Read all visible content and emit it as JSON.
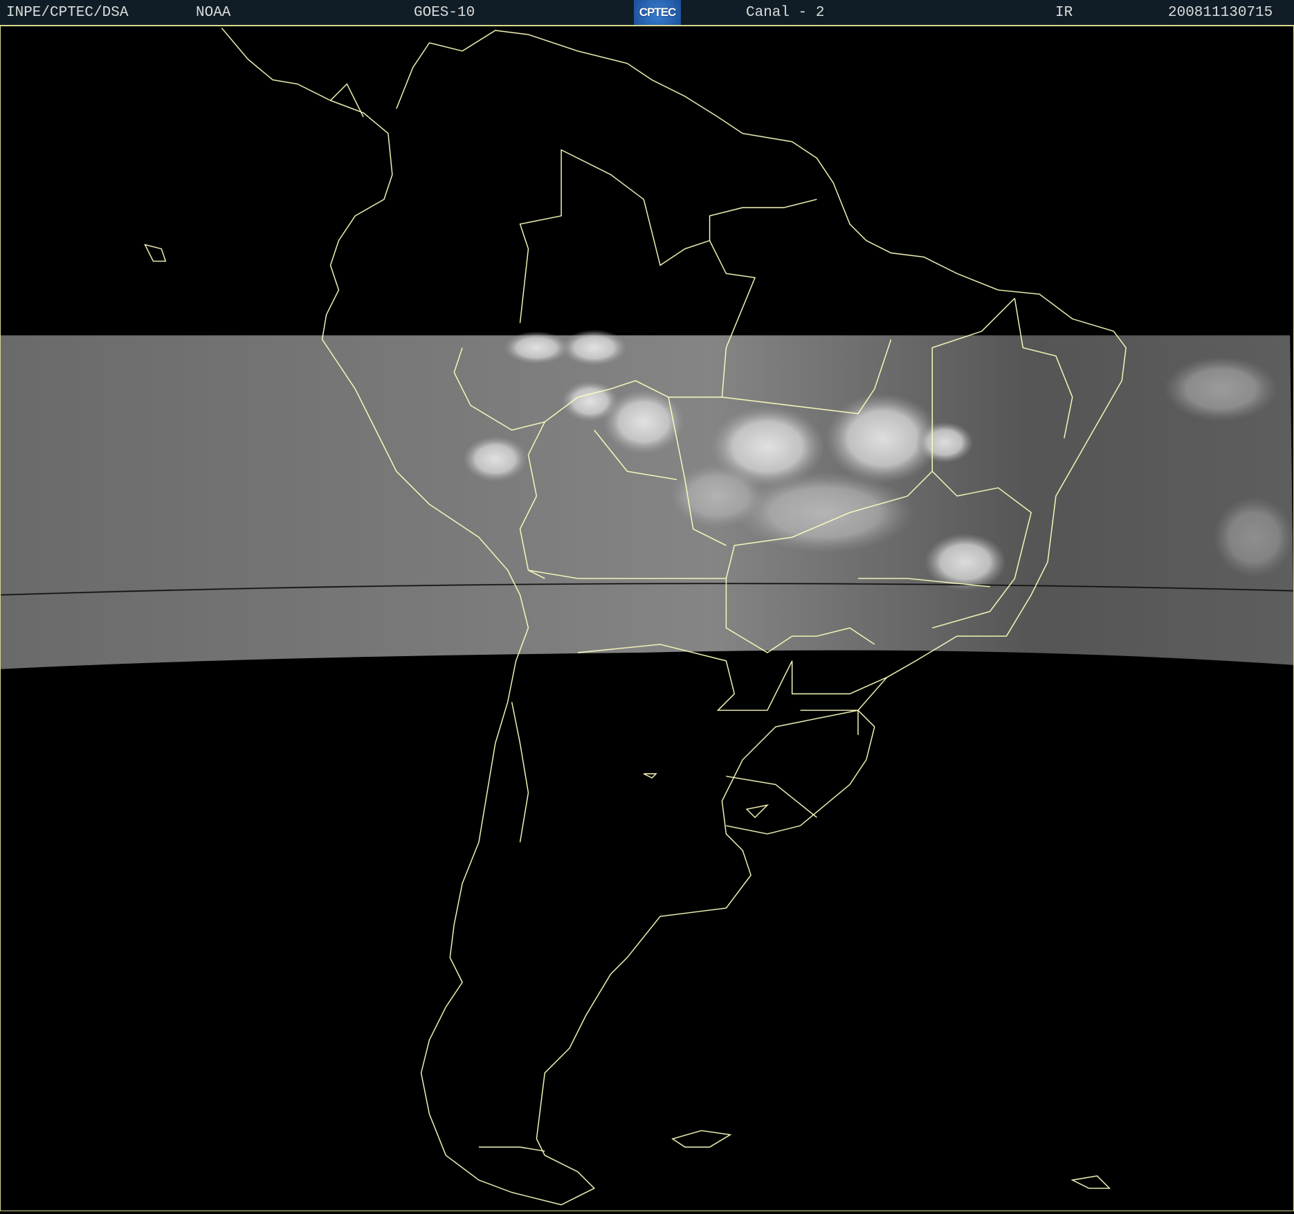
{
  "header": {
    "institution": "INPE/CPTEC/DSA",
    "agency": "NOAA",
    "satellite": "GOES-10",
    "channel": "Canal - 2",
    "band": "IR",
    "timestamp": "200811130715"
  },
  "logo": {
    "text": "CPTEC"
  },
  "colors": {
    "header_bg": "#111d26",
    "coastline": "#ffffc0",
    "background": "#000000"
  }
}
